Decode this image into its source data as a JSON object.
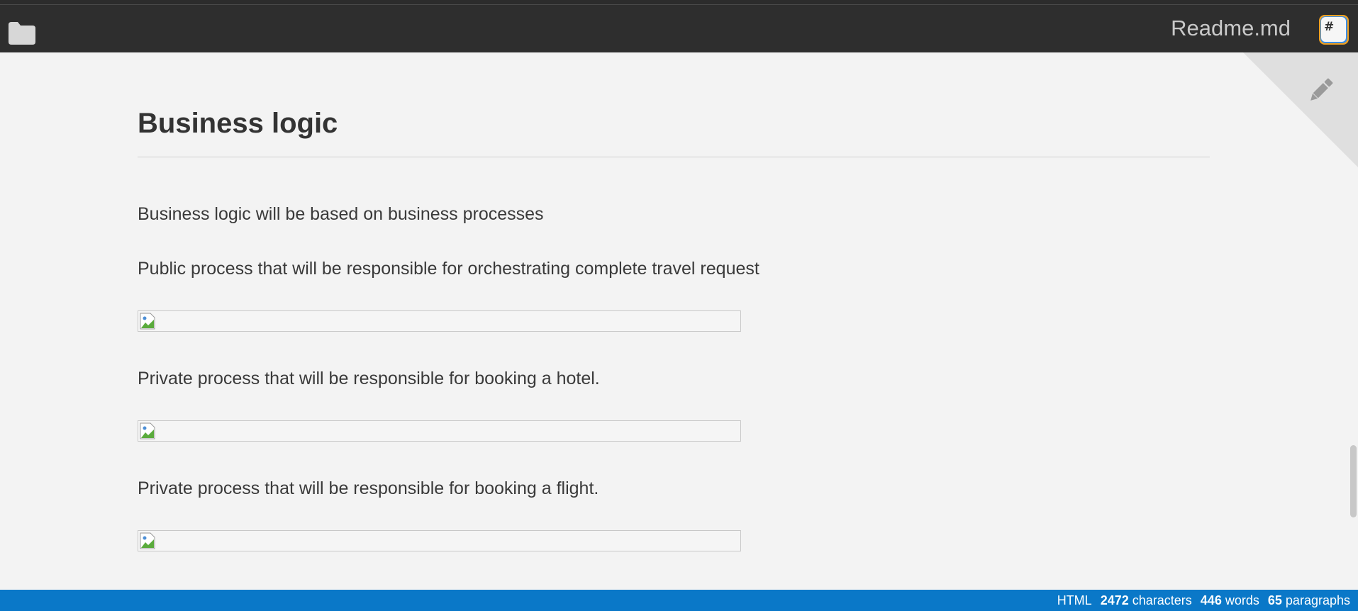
{
  "header": {
    "title": "Readme.md",
    "app_icon_glyph": "#"
  },
  "article": {
    "heading": "Business logic",
    "paragraphs": [
      "Business logic will be based on business processes",
      "Public process that will be responsible for orchestrating complete travel request",
      "Private process that will be responsible for booking a hotel.",
      "Private process that will be responsible for booking a flight."
    ]
  },
  "statusbar": {
    "mode": "HTML",
    "characters_count": "2472",
    "characters_label": "characters",
    "words_count": "446",
    "words_label": "words",
    "paragraphs_count": "65",
    "paragraphs_label": "paragraphs"
  },
  "colors": {
    "titlebar": "#2e2e2e",
    "content_bg": "#f3f3f3",
    "statusbar": "#0a78c8",
    "text": "#3a3a3a"
  },
  "icons": {
    "folder": "folder-icon",
    "app": "app-badge-icon",
    "edit": "pencil-icon",
    "broken_image": "broken-image-icon"
  }
}
